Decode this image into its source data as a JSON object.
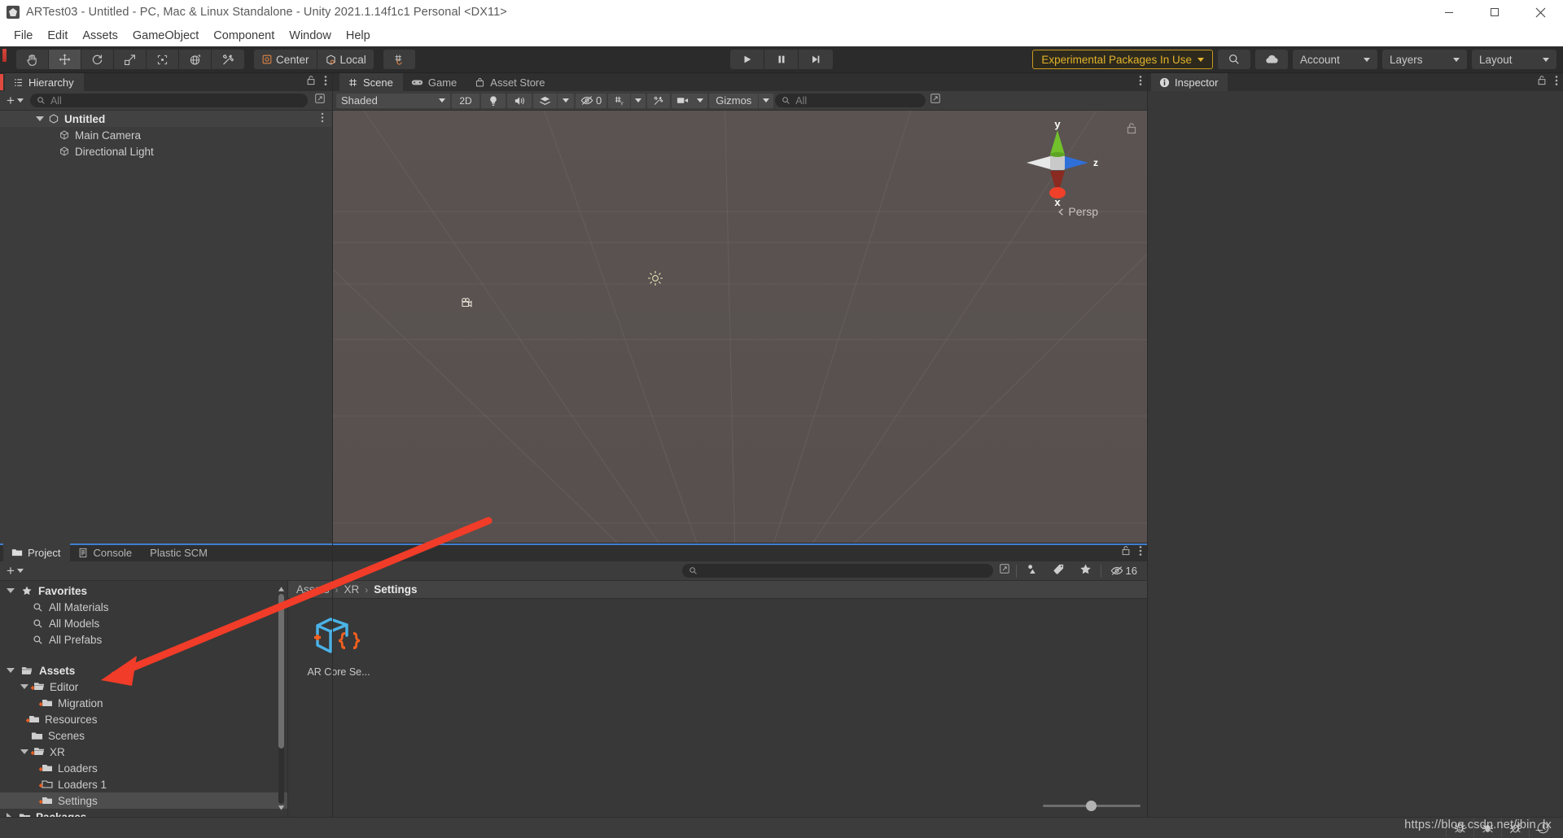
{
  "window": {
    "title": "ARTest03 - Untitled - PC, Mac & Linux Standalone - Unity 2021.1.14f1c1 Personal <DX11>",
    "app_icon": "unity-logo-icon",
    "minimize": "minimize-icon",
    "maximize": "maximize-icon",
    "close": "close-icon"
  },
  "menubar": {
    "items": [
      "File",
      "Edit",
      "Assets",
      "GameObject",
      "Component",
      "Window",
      "Help"
    ]
  },
  "toolbar": {
    "tools": [
      {
        "name": "hand-tool",
        "icon": "hand-icon",
        "active": false
      },
      {
        "name": "move-tool",
        "icon": "move-arrows-icon",
        "active": true
      },
      {
        "name": "rotate-tool",
        "icon": "rotate-icon",
        "active": false
      },
      {
        "name": "scale-tool",
        "icon": "scale-icon",
        "active": false
      },
      {
        "name": "rect-tool",
        "icon": "rect-transform-icon",
        "active": false
      },
      {
        "name": "transform-tool",
        "icon": "transform-icon",
        "active": false
      },
      {
        "name": "custom-tool",
        "icon": "wrench-screwdriver-icon",
        "active": false
      }
    ],
    "pivot_mode": "Center",
    "pivot_rotation": "Local",
    "grid_snap_icon": "grid-snap-icon",
    "play": "play-icon",
    "pause": "pause-icon",
    "step": "step-icon",
    "experimental_packages": "Experimental Packages In Use",
    "search_icon": "search-icon",
    "cloud_icon": "cloud-icon",
    "account": "Account",
    "layers": "Layers",
    "layout": "Layout"
  },
  "hierarchy": {
    "tab_label": "Hierarchy",
    "tab_icon": "hierarchy-icon",
    "lock_icon": "lock-icon",
    "menu_icon": "kebab-menu-icon",
    "add_label": "+",
    "search_placeholder": "All",
    "search_icon": "search-icon",
    "expand_icon": "expand-icon",
    "rows": [
      {
        "label": "Untitled",
        "icon": "scene-icon",
        "depth": 1,
        "scene": true
      },
      {
        "label": "Main Camera",
        "icon": "gameobject-cube-icon",
        "depth": 2,
        "scene": false
      },
      {
        "label": "Directional Light",
        "icon": "gameobject-cube-icon",
        "depth": 2,
        "scene": false
      }
    ]
  },
  "scene_panel": {
    "tabs": [
      {
        "label": "Scene",
        "icon": "scene-grid-icon",
        "active": true
      },
      {
        "label": "Game",
        "icon": "gamepad-icon",
        "active": false
      },
      {
        "label": "Asset Store",
        "icon": "asset-store-icon",
        "active": false
      }
    ],
    "menu_icon": "kebab-menu-icon",
    "draw_mode": "Shaded",
    "mode_2d": "2D",
    "lighting_icon": "lightbulb-icon",
    "audio_icon": "speaker-icon",
    "fx_icon": "effects-icon",
    "hidden_objects_count": "0",
    "hidden_icon": "eye-off-icon",
    "grid_icon": "grid-axis-icon",
    "scene_vis_icon": "scene-visibility-icon",
    "tools_icon": "wrench-screwdriver-icon",
    "camera_icon": "camera-icon",
    "gizmos_label": "Gizmos",
    "search_placeholder": "All",
    "search_icon": "search-icon",
    "expand_icon": "expand-icon",
    "gizmo": {
      "axis_y": "y",
      "axis_x": "x",
      "axis_z": "z",
      "projection": "Persp",
      "lock_icon": "lock-icon",
      "color_y": "#72c02c",
      "color_x": "#f04a28",
      "color_z": "#2f6fd8",
      "color_neutral": "#d8d8d8"
    }
  },
  "inspector": {
    "tab_label": "Inspector",
    "tab_icon": "info-icon",
    "lock_icon": "lock-icon",
    "menu_icon": "kebab-menu-icon"
  },
  "project_panel": {
    "tabs": [
      {
        "label": "Project",
        "icon": "folder-icon",
        "active": true
      },
      {
        "label": "Console",
        "icon": "console-icon",
        "active": false
      },
      {
        "label": "Plastic SCM",
        "icon": "",
        "active": false
      }
    ],
    "lock_icon": "lock-icon",
    "menu_icon": "kebab-menu-icon",
    "add_label": "+",
    "search_placeholder": "",
    "search_icon": "search-icon",
    "expand_icon": "expand-icon",
    "filter_type_icon": "filter-by-type-icon",
    "filter_label_icon": "filter-by-label-icon",
    "favorite_icon": "star-icon",
    "hidden_count": "16",
    "hidden_icon": "eye-off-icon",
    "tree": [
      {
        "label": "Favorites",
        "depth": 0,
        "icon": "star-icon",
        "arrow": "down",
        "bold": true,
        "selected": false
      },
      {
        "label": "All Materials",
        "depth": 1,
        "icon": "search-icon",
        "arrow": "",
        "bold": false,
        "selected": false
      },
      {
        "label": "All Models",
        "depth": 1,
        "icon": "search-icon",
        "arrow": "",
        "bold": false,
        "selected": false
      },
      {
        "label": "All Prefabs",
        "depth": 1,
        "icon": "search-icon",
        "arrow": "",
        "bold": false,
        "selected": false
      },
      {
        "label": "",
        "depth": 0,
        "icon": "",
        "arrow": "",
        "bold": false,
        "selected": false
      },
      {
        "label": "Assets",
        "depth": 0,
        "icon": "folder-open-icon",
        "arrow": "down",
        "bold": true,
        "selected": false
      },
      {
        "label": "Editor",
        "depth": 1,
        "icon": "folder-package-icon",
        "arrow": "down",
        "bold": false,
        "selected": false
      },
      {
        "label": "Migration",
        "depth": 2,
        "icon": "folder-package-icon",
        "arrow": "",
        "bold": false,
        "selected": false
      },
      {
        "label": "Resources",
        "depth": 1,
        "icon": "folder-package-icon",
        "arrow": "",
        "bold": false,
        "selected": false
      },
      {
        "label": "Scenes",
        "depth": 1,
        "icon": "folder-icon",
        "arrow": "",
        "bold": false,
        "selected": false
      },
      {
        "label": "XR",
        "depth": 1,
        "icon": "folder-package-icon",
        "arrow": "down",
        "bold": false,
        "selected": false
      },
      {
        "label": "Loaders",
        "depth": 2,
        "icon": "folder-package-icon",
        "arrow": "",
        "bold": false,
        "selected": false
      },
      {
        "label": "Loaders 1",
        "depth": 2,
        "icon": "folder-package-empty-icon",
        "arrow": "",
        "bold": false,
        "selected": false
      },
      {
        "label": "Settings",
        "depth": 2,
        "icon": "folder-package-icon",
        "arrow": "",
        "bold": false,
        "selected": true
      },
      {
        "label": "Packages",
        "depth": 0,
        "icon": "folder-icon",
        "arrow": "right",
        "bold": true,
        "selected": false
      }
    ],
    "breadcrumb": [
      "Assets",
      "XR",
      "Settings"
    ],
    "assets": [
      {
        "label": "AR Core Se...",
        "icon": "scriptable-object-asset-icon"
      }
    ],
    "zoom_value": "44"
  },
  "statusbar": {
    "watermark": "https://blog.csdn.net/jbin_lx",
    "icons": [
      "bug-icon",
      "bug-collapse-icon",
      "bug-mute-icon",
      "progress-icon"
    ]
  },
  "annotation": {
    "arrow_color": "#f03c28",
    "description": "red-arrow-pointing-to-assets"
  },
  "colors": {
    "accent_yellow": "#e3b32a",
    "panel_bg": "#383838",
    "panel_header": "#2f2f2f",
    "toolbar_bg": "#2b2b2b",
    "scene_bg": "#5a5351",
    "selection": "#4d4d4d"
  }
}
